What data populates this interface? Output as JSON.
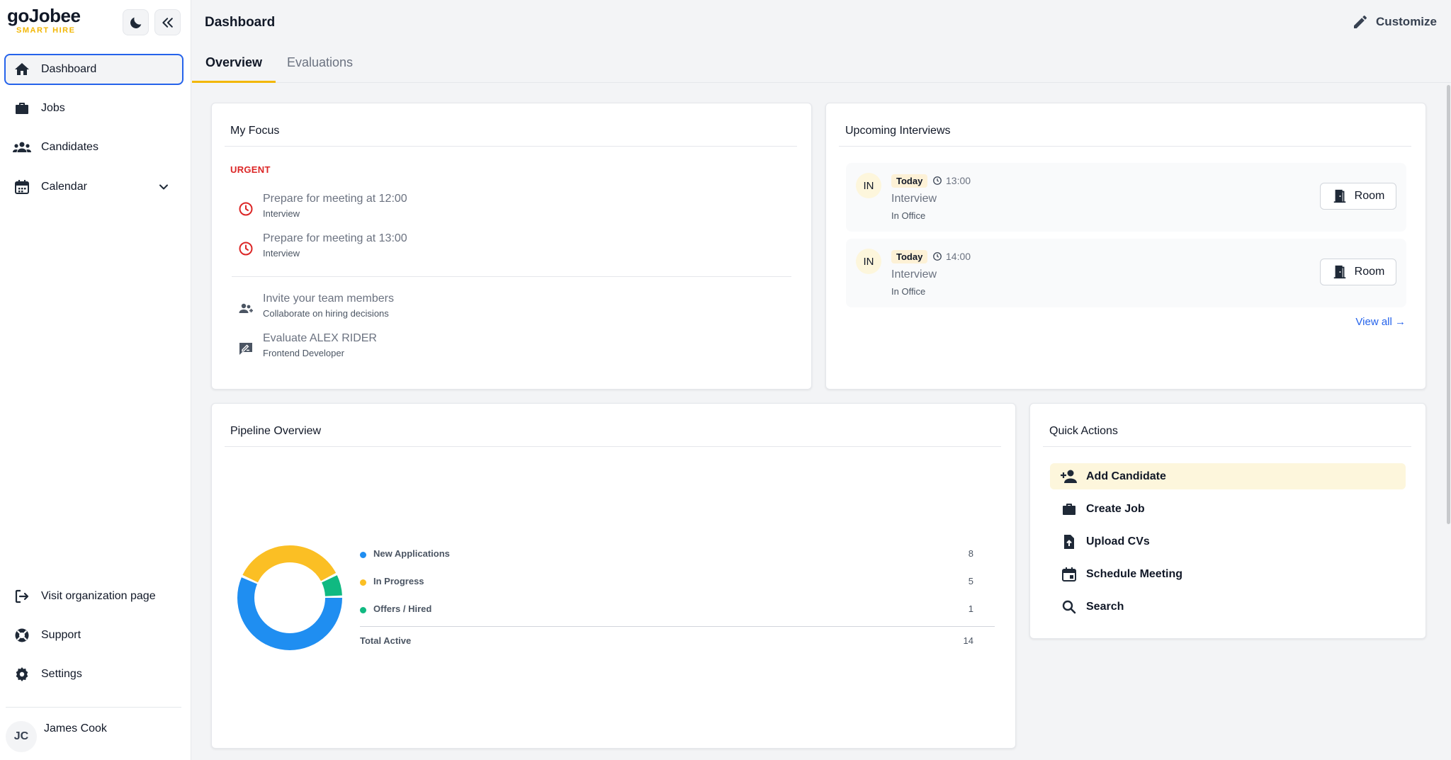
{
  "brand": {
    "name": "goJobee",
    "tagline": "SMART HIRE"
  },
  "sidebar": {
    "items": [
      {
        "label": "Dashboard",
        "icon": "home-icon"
      },
      {
        "label": "Jobs",
        "icon": "briefcase-icon"
      },
      {
        "label": "Candidates",
        "icon": "people-icon"
      },
      {
        "label": "Calendar",
        "icon": "calendar-icon"
      }
    ],
    "bottom": [
      {
        "label": "Visit organization page",
        "icon": "exit-icon"
      },
      {
        "label": "Support",
        "icon": "lifebuoy-icon"
      },
      {
        "label": "Settings",
        "icon": "gear-icon"
      }
    ],
    "user": {
      "initials": "JC",
      "name": "James Cook"
    }
  },
  "header": {
    "title": "Dashboard",
    "customize_label": "Customize"
  },
  "tabs": [
    {
      "label": "Overview",
      "active": true
    },
    {
      "label": "Evaluations",
      "active": false
    }
  ],
  "my_focus": {
    "title": "My Focus",
    "urgent_label": "URGENT",
    "urgent_items": [
      {
        "title": "Prepare for meeting at 12:00",
        "subtitle": "Interview"
      },
      {
        "title": "Prepare for meeting at 13:00",
        "subtitle": "Interview"
      }
    ],
    "other_items": [
      {
        "title": "Invite your team members",
        "subtitle": "Collaborate on hiring decisions"
      },
      {
        "title": "Evaluate ALEX RIDER",
        "subtitle": "Frontend Developer"
      }
    ]
  },
  "interviews": {
    "title": "Upcoming Interviews",
    "items": [
      {
        "badge": "IN",
        "day": "Today",
        "time": "13:00",
        "type": "Interview",
        "location": "In Office",
        "button": "Room"
      },
      {
        "badge": "IN",
        "day": "Today",
        "time": "14:00",
        "type": "Interview",
        "location": "In Office",
        "button": "Room"
      }
    ],
    "view_all": "View all →"
  },
  "pipeline": {
    "title": "Pipeline Overview",
    "total_label": "Total Active",
    "total_value": "14"
  },
  "chart_data": {
    "type": "pie",
    "categories": [
      "New Applications",
      "In Progress",
      "Offers / Hired"
    ],
    "values": [
      8,
      5,
      1
    ],
    "colors": [
      "#1f8ef1",
      "#fbbf24",
      "#10b981"
    ]
  },
  "quick_actions": {
    "title": "Quick Actions",
    "items": [
      {
        "label": "Add Candidate",
        "icon": "add-person-icon",
        "highlighted": true
      },
      {
        "label": "Create Job",
        "icon": "briefcase-icon",
        "highlighted": false
      },
      {
        "label": "Upload CVs",
        "icon": "upload-file-icon",
        "highlighted": false
      },
      {
        "label": "Schedule Meeting",
        "icon": "calendar-icon",
        "highlighted": false
      },
      {
        "label": "Search",
        "icon": "search-icon",
        "highlighted": false
      }
    ]
  },
  "colors": {
    "accent": "#f2b705",
    "link": "#2563eb",
    "urgent": "#dc2626"
  }
}
